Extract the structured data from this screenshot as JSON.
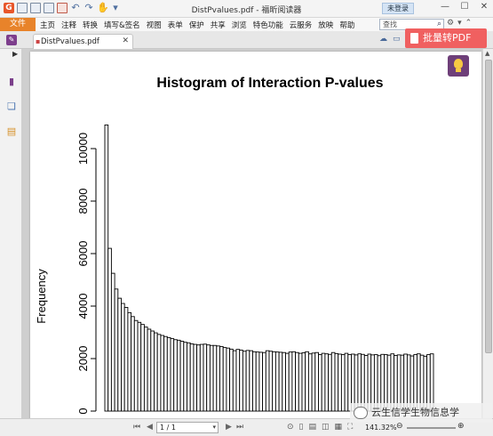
{
  "app": {
    "title": "DistPvalues.pdf - 福昕阅读器",
    "login_label": "未登录",
    "search_placeholder": "查找"
  },
  "menu": {
    "file_label": "文件",
    "items": [
      "主页",
      "注释",
      "转换",
      "填写&签名",
      "视图",
      "表单",
      "保护",
      "共享",
      "浏览",
      "特色功能",
      "云服务",
      "放映",
      "帮助"
    ]
  },
  "tab": {
    "label": "DistPvalues.pdf",
    "batch_convert_label": "批量转PDF"
  },
  "status": {
    "page_value": "1 / 1",
    "zoom_label": "141.32%"
  },
  "watermark": {
    "text": "云生信学生物信息学"
  },
  "chart_data": {
    "type": "bar",
    "title": "Histogram of Interaction P-values",
    "xlabel": "",
    "ylabel": "Frequency",
    "ylim": [
      0,
      11000
    ],
    "y_ticks": [
      "0",
      "2000",
      "4000",
      "6000",
      "8000",
      "10000"
    ],
    "y_tick_values": [
      0,
      2000,
      4000,
      6000,
      8000,
      10000
    ],
    "values": [
      10900,
      6200,
      5250,
      4650,
      4300,
      4100,
      3950,
      3750,
      3600,
      3450,
      3380,
      3300,
      3200,
      3120,
      3050,
      2980,
      2920,
      2880,
      2840,
      2800,
      2760,
      2720,
      2700,
      2660,
      2620,
      2600,
      2560,
      2540,
      2520,
      2540,
      2550,
      2520,
      2500,
      2500,
      2480,
      2460,
      2420,
      2400,
      2360,
      2300,
      2350,
      2320,
      2280,
      2310,
      2300,
      2260,
      2250,
      2240,
      2230,
      2300,
      2280,
      2260,
      2250,
      2240,
      2230,
      2200,
      2250,
      2260,
      2230,
      2200,
      2220,
      2260,
      2180,
      2210,
      2230,
      2150,
      2200,
      2180,
      2160,
      2230,
      2190,
      2170,
      2150,
      2200,
      2150,
      2170,
      2140,
      2180,
      2160,
      2120,
      2170,
      2140,
      2150,
      2110,
      2160,
      2150,
      2130,
      2180,
      2120,
      2140,
      2130,
      2170,
      2140,
      2100,
      2150,
      2180,
      2130,
      2090,
      2150,
      2180
    ],
    "grid": false,
    "legend": "none"
  }
}
